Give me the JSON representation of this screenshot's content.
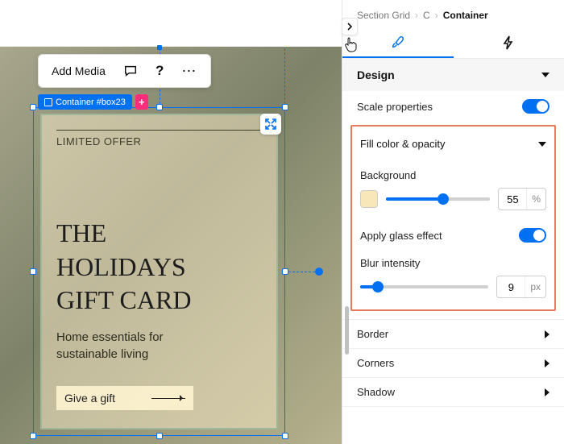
{
  "toolbar": {
    "add_media_label": "Add Media",
    "comment_icon": "chat-icon",
    "help_label": "?",
    "more_label": "⋯"
  },
  "selection": {
    "tag_label": "Container #box23",
    "plus_label": "+"
  },
  "card": {
    "eyebrow": "LIMITED OFFER",
    "title_line1": "THE",
    "title_line2": "HOLIDAYS",
    "title_line3": "GIFT CARD",
    "sub_line1": "Home essentials for",
    "sub_line2": "sustainable living",
    "cta_label": "Give a gift"
  },
  "breadcrumb": {
    "a": "Section Grid",
    "b": "C",
    "c": "Container"
  },
  "tabs": {
    "design_icon": "brush-icon",
    "action_icon": "bolt-icon"
  },
  "panel": {
    "design_label": "Design",
    "scale_label": "Scale properties",
    "fill_label": "Fill color & opacity",
    "background_label": "Background",
    "background_value": "55",
    "background_unit": "%",
    "background_swatch": "#f7e7b9",
    "glass_label": "Apply glass effect",
    "blur_label": "Blur intensity",
    "blur_value": "9",
    "blur_unit": "px",
    "border_label": "Border",
    "corners_label": "Corners",
    "shadow_label": "Shadow"
  }
}
